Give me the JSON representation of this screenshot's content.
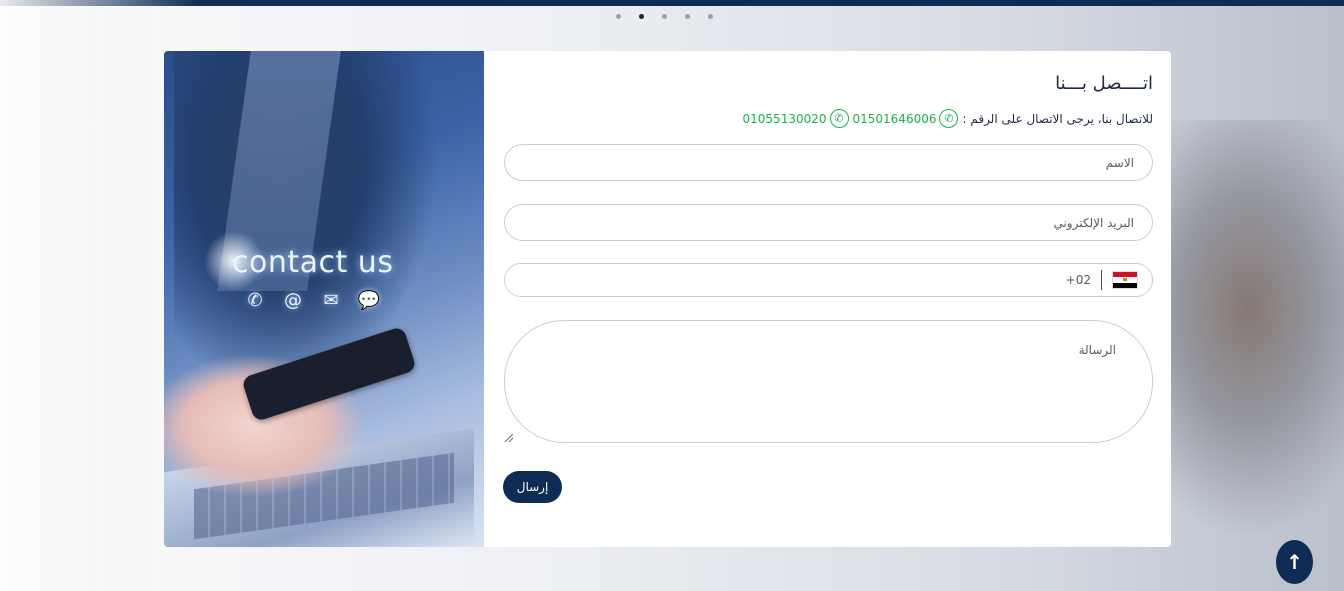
{
  "carousel": {
    "dots": 5,
    "active_index": 1
  },
  "photo": {
    "caption": "contact us",
    "icons": [
      "phone-icon",
      "at-icon",
      "envelope-icon",
      "chat-icon"
    ]
  },
  "form": {
    "title": "اتــــصل بـــنا",
    "phones_label": "للاتصال بنا، يرجى الاتصال على الرقم :",
    "phone_1": "01501646006",
    "phone_2": "01055130020",
    "name_placeholder": "الاسم",
    "email_placeholder": "البريد الإلكتروني",
    "tel_code": "+02",
    "message_placeholder": "الرسالة",
    "submit_label": "إرسال"
  },
  "colors": {
    "primary": "#0f2c54",
    "whatsapp": "#1bb34a"
  }
}
